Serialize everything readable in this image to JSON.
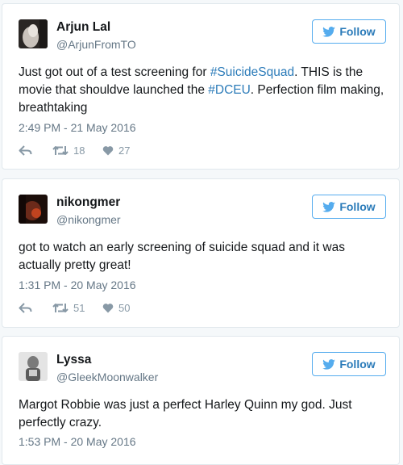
{
  "ui": {
    "follow_label": "Follow",
    "colors": {
      "accent": "#55acee",
      "link": "#2b7bb9",
      "muted": "#657786",
      "icon": "#8899a6"
    }
  },
  "tweets": [
    {
      "name": "Arjun Lal",
      "handle": "@ArjunFromTO",
      "text_parts": [
        "Just got out of a test screening for ",
        "#SuicideSquad",
        ". THIS is the movie that shouldve launched the ",
        "#DCEU",
        ". Perfection film making, breathtaking"
      ],
      "timestamp": "2:49 PM - 21 May 2016",
      "retweets": "18",
      "likes": "27"
    },
    {
      "name": "nikongmer",
      "handle": "@nikongmer",
      "text": "got to watch an early screening of suicide squad and it was actually pretty great!",
      "timestamp": "1:31 PM - 20 May 2016",
      "retweets": "51",
      "likes": "50"
    },
    {
      "name": "Lyssa",
      "handle": "@GleekMoonwalker",
      "text": "Margot Robbie was just a perfect Harley Quinn my god. Just perfectly crazy.",
      "timestamp": "1:53 PM - 20 May 2016"
    }
  ]
}
